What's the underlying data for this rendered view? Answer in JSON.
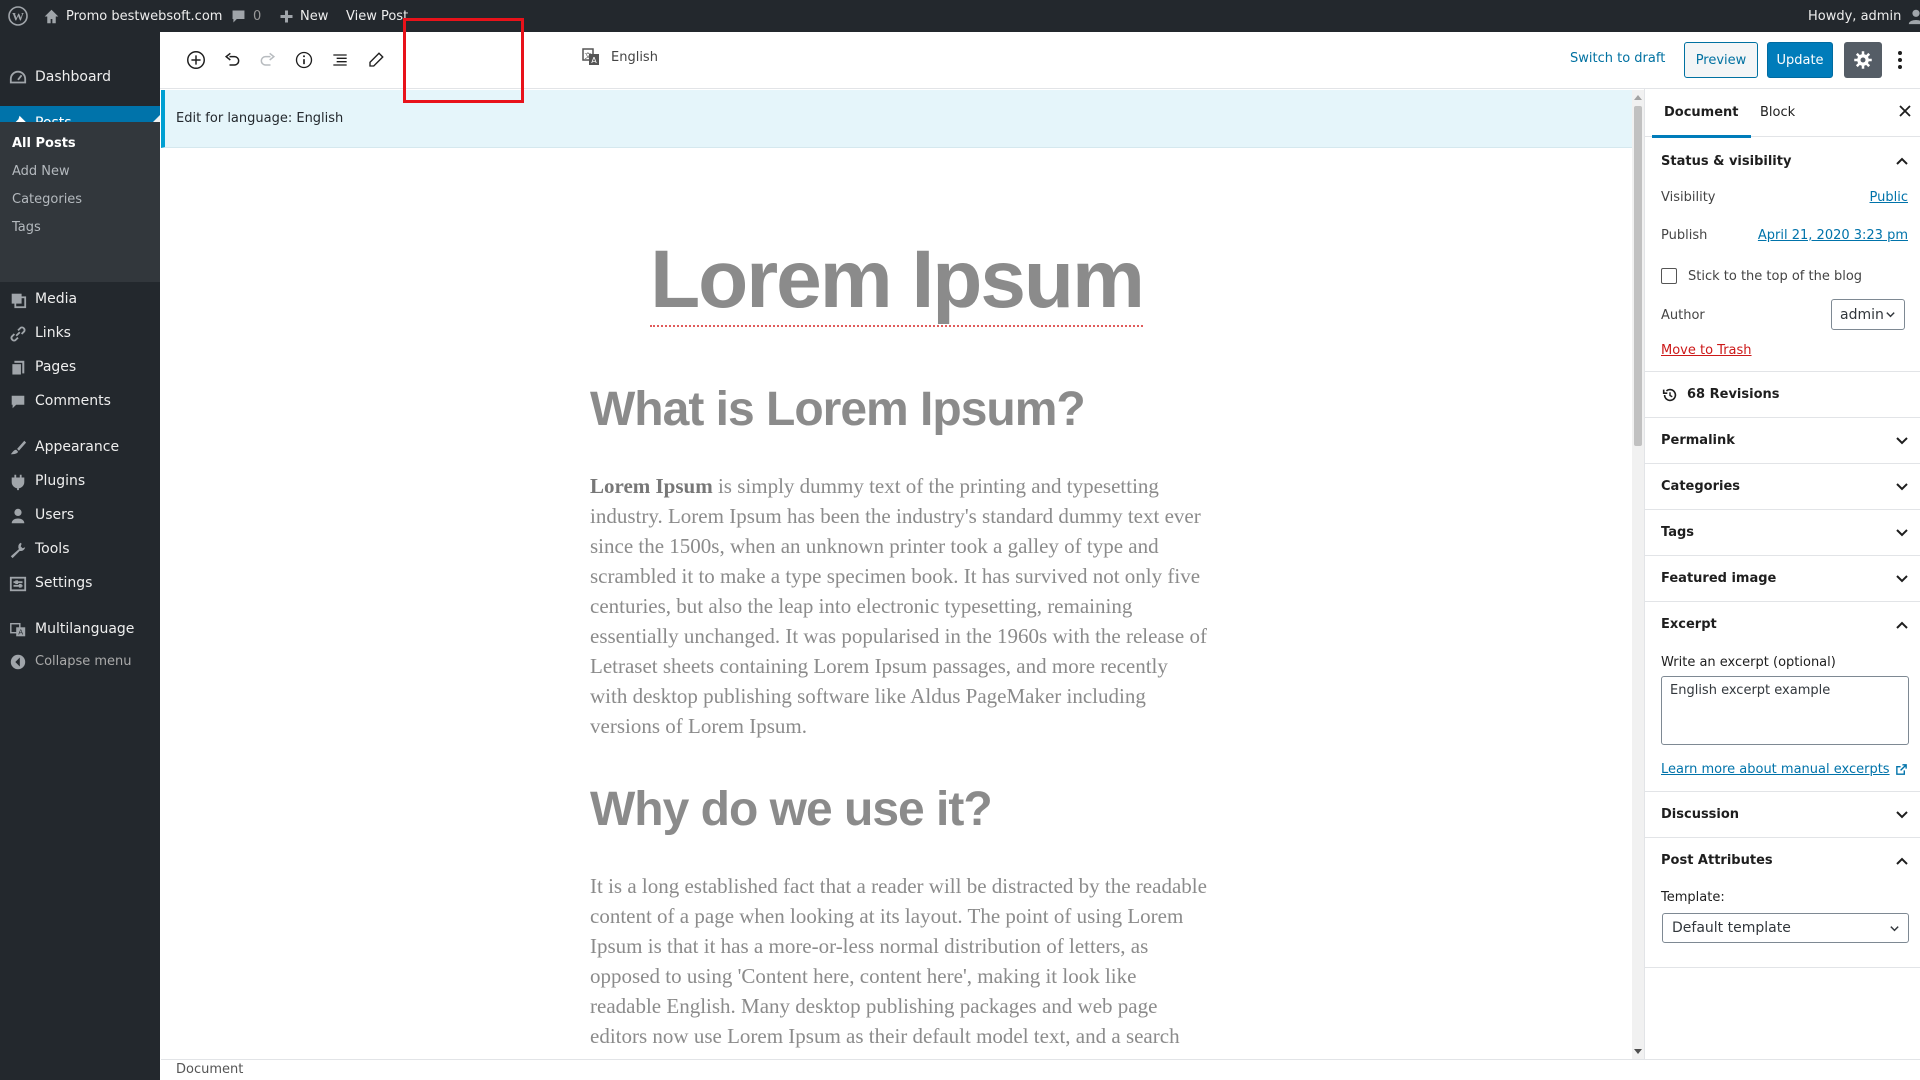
{
  "adminbar": {
    "site_name": "Promo bestwebsoft.com",
    "comments_count": "0",
    "new_label": "New",
    "view_post": "View Post",
    "howdy": "Howdy, admin"
  },
  "menu": {
    "dashboard": "Dashboard",
    "posts": "Posts",
    "submenu": [
      "All Posts",
      "Add New",
      "Categories",
      "Tags"
    ],
    "media": "Media",
    "links": "Links",
    "pages": "Pages",
    "comments": "Comments",
    "appearance": "Appearance",
    "plugins": "Plugins",
    "users": "Users",
    "tools": "Tools",
    "settings": "Settings",
    "multilanguage": "Multilanguage",
    "collapse": "Collapse menu"
  },
  "toolbar": {
    "language": "English",
    "switch_to_draft": "Switch to draft",
    "preview": "Preview",
    "update": "Update"
  },
  "notice": "Edit for language: English",
  "post": {
    "title": "Lorem Ipsum",
    "heading1": "What is Lorem Ipsum?",
    "para1_bold": "Lorem Ipsum",
    "para1_rest": " is simply dummy text of the printing and typesetting industry. Lorem Ipsum has been the industry's standard dummy text ever since the 1500s, when an unknown printer took a galley of type and scrambled it to make a type specimen book. It has survived not only five centuries, but also the leap into electronic typesetting, remaining essentially unchanged. It was popularised in the 1960s with the release of Letraset sheets containing Lorem Ipsum passages, and more recently with desktop publishing software like Aldus PageMaker including versions of Lorem Ipsum.",
    "heading2": "Why do we use it?",
    "para2": "It is a long established fact that a reader will be distracted by the readable content of a page when looking at its layout. The point of using Lorem Ipsum is that it has a more-or-less normal distribution of letters, as opposed to using 'Content here, content here', making it look like readable English. Many desktop publishing packages and web page editors now use Lorem Ipsum as their default model text, and a search"
  },
  "footer": "Document",
  "settings": {
    "tab_document": "Document",
    "tab_block": "Block",
    "status_visibility": "Status & visibility",
    "visibility_label": "Visibility",
    "visibility_value": "Public",
    "publish_label": "Publish",
    "publish_value": "April 21, 2020 3:23 pm",
    "sticky_label": "Stick to the top of the blog",
    "author_label": "Author",
    "author_value": "admin",
    "move_to_trash": "Move to Trash",
    "revisions": "68 Revisions",
    "permalink": "Permalink",
    "categories": "Categories",
    "tags": "Tags",
    "featured_image": "Featured image",
    "excerpt": "Excerpt",
    "excerpt_label": "Write an excerpt (optional)",
    "excerpt_value": "English excerpt example",
    "excerpt_link": "Learn more about manual excerpts",
    "discussion": "Discussion",
    "post_attributes": "Post Attributes",
    "template_label": "Template:",
    "template_value": "Default template"
  }
}
